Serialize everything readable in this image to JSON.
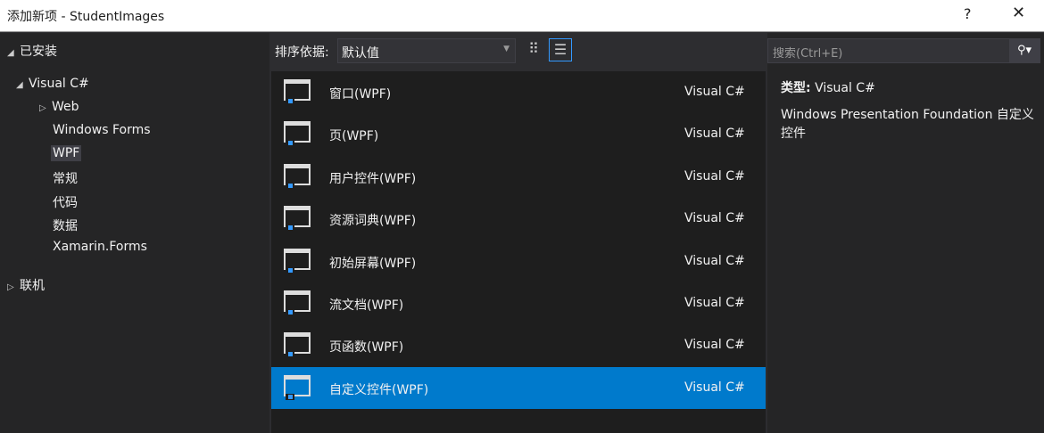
{
  "window": {
    "title": "添加新项 - StudentImages",
    "help": "?",
    "close": "✕"
  },
  "tree": {
    "installed": "已安装",
    "visual_csharp": "Visual C#",
    "items": [
      "Web",
      "Windows Forms",
      "WPF",
      "常规",
      "代码",
      "数据",
      "Xamarin.Forms"
    ],
    "online": "联机"
  },
  "toolbar": {
    "sort_label": "排序依据:",
    "sort_value": "默认值"
  },
  "templates": [
    {
      "name": "窗口(WPF)",
      "lang": "Visual C#"
    },
    {
      "name": "页(WPF)",
      "lang": "Visual C#"
    },
    {
      "name": "用户控件(WPF)",
      "lang": "Visual C#"
    },
    {
      "name": "资源词典(WPF)",
      "lang": "Visual C#"
    },
    {
      "name": "初始屏幕(WPF)",
      "lang": "Visual C#"
    },
    {
      "name": "流文档(WPF)",
      "lang": "Visual C#"
    },
    {
      "name": "页函数(WPF)",
      "lang": "Visual C#"
    },
    {
      "name": "自定义控件(WPF)",
      "lang": "Visual C#"
    }
  ],
  "search": {
    "placeholder": "搜索(Ctrl+E)"
  },
  "details": {
    "type_label": "类型:",
    "type_value": "Visual C#",
    "description": "Windows Presentation Foundation 自定义控件"
  },
  "colors": {
    "accent": "#007acc",
    "bg": "#2d2d30"
  }
}
